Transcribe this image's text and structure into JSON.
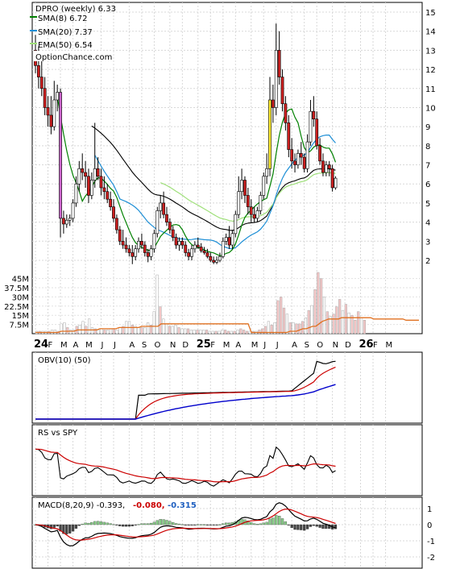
{
  "chart_data": {
    "type": "candlestick",
    "symbol": "DPRO",
    "period": "weekly",
    "last_price": "6.33",
    "watermark": "OptionChance.com",
    "price_legend": [
      {
        "label": "DPRO (weekly) 6.33",
        "color": "#000000"
      },
      {
        "label": "SMA(8) 6.72",
        "color": "#008000"
      },
      {
        "label": "SMA(20) 7.37",
        "color": "#1e8fd6"
      },
      {
        "label": "EMA(50) 6.54",
        "color": "#9fe07a"
      }
    ],
    "price_axis_ticks": [
      "15",
      "14",
      "13",
      "12",
      "11",
      "10",
      "9",
      "8",
      "7",
      "6",
      "5",
      "4",
      "3",
      "2"
    ],
    "price_ylim": [
      2,
      15
    ],
    "volume_axis_ticks": [
      "45M",
      "37.5M",
      "30M",
      "22.5M",
      "15M",
      "7.5M"
    ],
    "volume_ylim": [
      0,
      50
    ],
    "x_tick_labels": [
      "24",
      "F",
      "M",
      "A",
      "M",
      "J",
      "J",
      "A",
      "S",
      "O",
      "N",
      "D",
      "25",
      "F",
      "M",
      "A",
      "M",
      "J",
      "J",
      "A",
      "S",
      "O",
      "N",
      "D",
      "26",
      "F",
      "M"
    ],
    "x_tick_weeks": [
      0,
      4,
      8,
      12,
      16,
      21,
      25,
      30,
      34,
      38,
      43,
      47,
      52,
      56,
      60,
      64,
      69,
      73,
      77,
      82,
      86,
      90,
      95,
      99,
      104,
      108,
      112
    ],
    "x_bold_labels": [
      "24",
      "25",
      "26"
    ],
    "ohlc_weekly": [
      [
        13.0,
        13.8,
        11.8,
        12.2
      ],
      [
        12.2,
        13.2,
        11.0,
        11.6
      ],
      [
        11.6,
        12.6,
        10.6,
        11.0
      ],
      [
        11.0,
        11.6,
        9.6,
        10.0
      ],
      [
        10.0,
        10.6,
        9.0,
        9.6
      ],
      [
        9.6,
        10.6,
        8.6,
        9.0
      ],
      [
        9.0,
        11.4,
        8.8,
        10.4
      ],
      [
        10.4,
        11.2,
        9.8,
        10.8
      ],
      [
        10.8,
        11.0,
        3.2,
        4.2
      ],
      [
        4.2,
        4.6,
        3.4,
        3.9
      ],
      [
        3.9,
        4.4,
        3.7,
        4.1
      ],
      [
        4.1,
        4.4,
        3.8,
        4.2
      ],
      [
        4.2,
        5.2,
        4.0,
        5.0
      ],
      [
        5.0,
        6.4,
        4.8,
        6.0
      ],
      [
        6.0,
        7.2,
        5.6,
        6.8
      ],
      [
        6.8,
        7.6,
        6.2,
        6.6
      ],
      [
        6.6,
        7.2,
        5.8,
        6.4
      ],
      [
        6.4,
        6.8,
        5.0,
        5.4
      ],
      [
        5.4,
        6.6,
        5.2,
        6.2
      ],
      [
        6.2,
        9.2,
        5.8,
        6.8
      ],
      [
        6.8,
        7.4,
        6.2,
        6.4
      ],
      [
        6.4,
        6.8,
        5.4,
        5.8
      ],
      [
        5.8,
        6.4,
        5.2,
        5.6
      ],
      [
        5.6,
        6.0,
        5.0,
        5.2
      ],
      [
        5.2,
        5.6,
        4.6,
        4.8
      ],
      [
        4.8,
        5.2,
        4.0,
        4.2
      ],
      [
        4.2,
        4.4,
        3.4,
        3.6
      ],
      [
        3.6,
        3.8,
        2.8,
        3.0
      ],
      [
        3.0,
        3.6,
        2.6,
        2.8
      ],
      [
        2.8,
        3.2,
        2.4,
        2.6
      ],
      [
        2.6,
        2.8,
        2.2,
        2.4
      ],
      [
        2.4,
        2.8,
        1.8,
        2.2
      ],
      [
        2.2,
        2.8,
        2.0,
        2.6
      ],
      [
        2.6,
        3.2,
        2.4,
        3.0
      ],
      [
        3.0,
        3.4,
        2.6,
        2.8
      ],
      [
        2.8,
        3.0,
        2.2,
        2.4
      ],
      [
        2.4,
        2.6,
        1.9,
        2.2
      ],
      [
        2.2,
        2.8,
        2.0,
        2.6
      ],
      [
        2.6,
        3.6,
        2.4,
        3.4
      ],
      [
        3.4,
        4.8,
        3.2,
        4.6
      ],
      [
        4.6,
        5.4,
        4.2,
        5.0
      ],
      [
        5.0,
        5.6,
        4.2,
        4.4
      ],
      [
        4.4,
        4.8,
        3.8,
        4.0
      ],
      [
        4.0,
        4.2,
        3.4,
        3.6
      ],
      [
        3.6,
        3.8,
        3.0,
        3.2
      ],
      [
        3.2,
        3.4,
        2.6,
        2.8
      ],
      [
        2.8,
        3.2,
        2.5,
        3.0
      ],
      [
        3.0,
        3.2,
        2.6,
        2.8
      ],
      [
        2.8,
        3.0,
        2.2,
        2.4
      ],
      [
        2.4,
        2.6,
        2.0,
        2.2
      ],
      [
        2.2,
        2.8,
        2.0,
        2.6
      ],
      [
        2.6,
        3.0,
        2.4,
        2.8
      ],
      [
        2.8,
        3.2,
        2.6,
        2.7
      ],
      [
        2.7,
        2.9,
        2.4,
        2.5
      ],
      [
        2.5,
        2.7,
        2.3,
        2.4
      ],
      [
        2.4,
        2.6,
        2.1,
        2.2
      ],
      [
        2.2,
        2.4,
        1.9,
        2.0
      ],
      [
        2.0,
        2.2,
        1.8,
        1.9
      ],
      [
        1.9,
        2.2,
        1.8,
        2.0
      ],
      [
        2.0,
        2.4,
        1.9,
        2.2
      ],
      [
        2.2,
        3.2,
        2.1,
        3.0
      ],
      [
        3.0,
        3.4,
        2.8,
        3.2
      ],
      [
        3.2,
        3.8,
        2.6,
        2.8
      ],
      [
        2.8,
        3.6,
        2.6,
        3.4
      ],
      [
        3.4,
        4.6,
        3.2,
        4.4
      ],
      [
        4.4,
        6.4,
        4.2,
        5.6
      ],
      [
        5.6,
        6.8,
        5.2,
        6.2
      ],
      [
        6.2,
        6.4,
        5.0,
        5.4
      ],
      [
        5.4,
        5.8,
        4.4,
        4.8
      ],
      [
        4.8,
        5.2,
        4.0,
        4.4
      ],
      [
        4.4,
        4.8,
        4.0,
        4.2
      ],
      [
        4.2,
        4.8,
        4.0,
        4.6
      ],
      [
        4.6,
        5.6,
        4.4,
        5.4
      ],
      [
        5.4,
        6.6,
        5.2,
        6.4
      ],
      [
        6.4,
        7.6,
        6.0,
        6.8
      ],
      [
        6.8,
        11.6,
        6.4,
        10.4
      ],
      [
        10.4,
        11.2,
        9.2,
        10.0
      ],
      [
        10.0,
        14.4,
        9.6,
        13.0
      ],
      [
        13.0,
        14.0,
        11.2,
        11.6
      ],
      [
        11.6,
        12.0,
        9.8,
        10.2
      ],
      [
        10.2,
        10.6,
        8.8,
        9.2
      ],
      [
        9.2,
        9.6,
        7.4,
        7.8
      ],
      [
        7.8,
        8.4,
        6.8,
        7.2
      ],
      [
        7.2,
        7.6,
        6.6,
        7.0
      ],
      [
        7.0,
        7.8,
        6.8,
        7.6
      ],
      [
        7.6,
        8.2,
        7.0,
        7.4
      ],
      [
        7.4,
        7.6,
        6.6,
        6.8
      ],
      [
        6.8,
        8.6,
        6.6,
        8.2
      ],
      [
        8.2,
        10.4,
        8.0,
        9.8
      ],
      [
        9.8,
        10.6,
        9.0,
        9.4
      ],
      [
        9.4,
        9.8,
        7.8,
        8.0
      ],
      [
        8.0,
        8.4,
        7.0,
        7.2
      ],
      [
        7.2,
        7.6,
        6.4,
        6.6
      ],
      [
        6.6,
        7.2,
        6.4,
        7.0
      ],
      [
        7.0,
        7.2,
        6.4,
        6.8
      ],
      [
        6.8,
        7.0,
        5.6,
        5.8
      ],
      [
        5.8,
        6.4,
        5.7,
        6.3
      ]
    ],
    "volume_ma_weekly": [
      1,
      1,
      1,
      1,
      1,
      1,
      1,
      1,
      2,
      2,
      2,
      2,
      2,
      3,
      3,
      3,
      3,
      3,
      3,
      3,
      4,
      4,
      4,
      4,
      4,
      4,
      5,
      5,
      5,
      5,
      5,
      5,
      5,
      6,
      6,
      6,
      6,
      6,
      6,
      8,
      8,
      8,
      8,
      8,
      8,
      8,
      8,
      8,
      8,
      8,
      8,
      8,
      8,
      8,
      8,
      8,
      8,
      8,
      8,
      8,
      8,
      8,
      8,
      8,
      8,
      8,
      8,
      1,
      1,
      1,
      1,
      1,
      1,
      1,
      1,
      1,
      1,
      1,
      1,
      2,
      2,
      2,
      3,
      4,
      4,
      5,
      6,
      6,
      8,
      10,
      11,
      12,
      12,
      12,
      12,
      13,
      13,
      13,
      13,
      13,
      13,
      13,
      13,
      13,
      13,
      12,
      12,
      12,
      12,
      12,
      12,
      12,
      12,
      12,
      12,
      11,
      11,
      11,
      11,
      11
    ],
    "volume_weekly": [
      2,
      2,
      2,
      2,
      2,
      3,
      3,
      2,
      8,
      9,
      5,
      3,
      3,
      6,
      7,
      10,
      6,
      12,
      5,
      4,
      3,
      4,
      3,
      3,
      4,
      4,
      3,
      5,
      6,
      10,
      10,
      7,
      6,
      5,
      5,
      5,
      9,
      7,
      18,
      48,
      22,
      12,
      8,
      6,
      6,
      7,
      5,
      4,
      4,
      4,
      3,
      3,
      3,
      3,
      3,
      3,
      2,
      2,
      2,
      2,
      3,
      3,
      2,
      2,
      2,
      3,
      4,
      3,
      2,
      2,
      2,
      2,
      3,
      4,
      6,
      10,
      7,
      9,
      27,
      30,
      21,
      16,
      9,
      9,
      8,
      8,
      10,
      13,
      19,
      23,
      36,
      50,
      45,
      30,
      18,
      14,
      16,
      22,
      28,
      19,
      24,
      17,
      15,
      11,
      18,
      13,
      11,
      9,
      14,
      15,
      12,
      12,
      16,
      18,
      14,
      10,
      9,
      9,
      12,
      10,
      9,
      8,
      8,
      8,
      8
    ],
    "obv_legend": "OBV(10) (50)",
    "rs_legend": "RS vs SPY",
    "macd_legend": {
      "label": "MACD(8,20,9) -0.393,",
      "signal": "-0.080,",
      "hist": "-0.315"
    },
    "macd_axis_ticks": [
      "1",
      "0",
      "-1",
      "-2"
    ],
    "macd_ylim": [
      -2.6,
      1.6
    ],
    "colors": {
      "up": "#ffffff",
      "down": "#cc2020",
      "wick": "#000000",
      "sma8": "#008000",
      "sma20": "#1e8fd6",
      "ema50": "#9fe07a",
      "long": "#000000",
      "volume": "#bbbbbb",
      "vol_ma": "#e07020",
      "obv_fast": "#cc0000",
      "obv_slow": "#0000cc",
      "rs_signal": "#cc0000",
      "macd_pos": "#88cc88",
      "macd_neg": "#444444",
      "signal_red": "#cc0000",
      "hist_blue": "#2060c0"
    }
  }
}
